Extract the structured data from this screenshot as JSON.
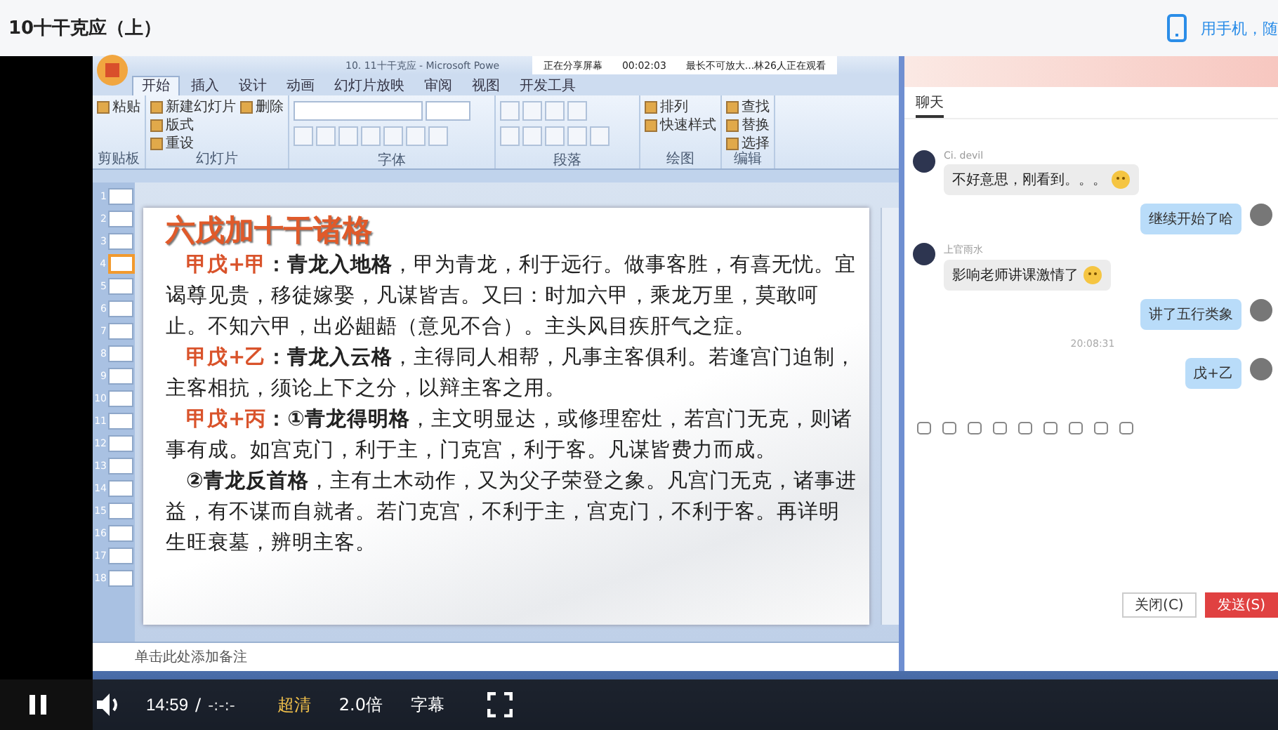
{
  "page": {
    "title": "10十干克应（上）",
    "mobile_link": "用手机，随"
  },
  "ppt": {
    "window_title": "10. 11十干克应 - Microsoft Powe",
    "share_bar": {
      "status": "正在分享屏幕",
      "time": "00:02:03",
      "notice": "最长不可放大...林26人正在观看"
    },
    "tabs": [
      {
        "label": "开始",
        "selected": true
      },
      {
        "label": "插入",
        "selected": false
      },
      {
        "label": "设计",
        "selected": false
      },
      {
        "label": "动画",
        "selected": false
      },
      {
        "label": "幻灯片放映",
        "selected": false
      },
      {
        "label": "审阅",
        "selected": false
      },
      {
        "label": "视图",
        "selected": false
      },
      {
        "label": "开发工具",
        "selected": false
      }
    ],
    "ribbon_groups": [
      {
        "label": "剪贴板",
        "kind": "buttons",
        "buttons": [
          "粘贴"
        ]
      },
      {
        "label": "幻灯片",
        "kind": "buttons",
        "buttons": [
          "新建幻灯片",
          "版式",
          "重设",
          "删除"
        ]
      },
      {
        "label": "字体",
        "kind": "font"
      },
      {
        "label": "段落",
        "kind": "paragraph"
      },
      {
        "label": "绘图",
        "kind": "buttons",
        "buttons": [
          "排列",
          "快速样式"
        ]
      },
      {
        "label": "编辑",
        "kind": "buttons",
        "buttons": [
          "查找",
          "替换",
          "选择"
        ]
      }
    ],
    "thumbnails": [
      {
        "number": "1",
        "selected": false
      },
      {
        "number": "2",
        "selected": false
      },
      {
        "number": "3",
        "selected": false
      },
      {
        "number": "4",
        "selected": true
      },
      {
        "number": "5",
        "selected": false
      },
      {
        "number": "6",
        "selected": false
      },
      {
        "number": "7",
        "selected": false
      },
      {
        "number": "8",
        "selected": false
      },
      {
        "number": "9",
        "selected": false
      },
      {
        "number": "10",
        "selected": false
      },
      {
        "number": "11",
        "selected": false
      },
      {
        "number": "12",
        "selected": false
      },
      {
        "number": "13",
        "selected": false
      },
      {
        "number": "14",
        "selected": false
      },
      {
        "number": "15",
        "selected": false
      },
      {
        "number": "16",
        "selected": false
      },
      {
        "number": "17",
        "selected": false
      },
      {
        "number": "18",
        "selected": false
      }
    ],
    "slide": {
      "title": "六戊加十干诸格",
      "paragraphs": [
        {
          "label": "甲戊+甲",
          "heading": "：青龙入地格",
          "text": "，甲为青龙，利于远行。做事客胜，有喜无忧。宜谒尊见贵，移徒嫁娶，凡谋皆吉。又曰：时加六甲，乘龙万里，莫敢呵止。不知六甲，出必龃龉（意见不合）。主头风目疾肝气之症。"
        },
        {
          "label": "甲戊+乙",
          "heading": "：青龙入云格",
          "text": "，主得同人相帮，凡事主客俱利。若逢宫门迫制，主客相抗，须论上下之分，以辩主客之用。"
        },
        {
          "label": "甲戊+丙",
          "heading": "：①青龙得明格",
          "text": "，主文明显达，或修理窑灶，若宫门无克，则诸事有成。如宫克门，利于主，门克宫，利于客。凡谋皆费力而成。"
        },
        {
          "heading": "②青龙反首格",
          "text": "，主有土木动作，又为父子荣登之象。凡宫门无克，诸事进益，有不谋而自就者。若门克宫，不利于主，宫克门，不利于客。再详明生旺衰墓，辨明主客。"
        }
      ]
    },
    "notes_placeholder": "单击此处添加备注"
  },
  "chat": {
    "tabs": [
      {
        "label": "聊天",
        "selected": true
      }
    ],
    "messages": [
      {
        "kind": "incoming",
        "sender": "Ci. devil",
        "text": "不好意思，刚看到。。。",
        "emoji": true
      },
      {
        "kind": "outgoing",
        "text": "继续开始了哈",
        "emoji": false
      },
      {
        "kind": "incoming",
        "sender": "上官雨水",
        "text": "影响老师讲课激情了",
        "emoji": true
      },
      {
        "kind": "outgoing",
        "text": "讲了五行类象",
        "emoji": false
      },
      {
        "kind": "time",
        "text": "20:08:31"
      },
      {
        "kind": "outgoing",
        "text": "戊+乙",
        "emoji": false
      }
    ],
    "buttons": [
      {
        "label": "关闭(C)",
        "kind": "plain"
      },
      {
        "label": "发送(S)",
        "kind": "primary"
      }
    ]
  },
  "player": {
    "playing": true,
    "current_time": "14:59",
    "separator": "/",
    "duration": "-:-:-",
    "quality": "超清",
    "speed": "2.0倍",
    "subtitles": "字幕"
  }
}
